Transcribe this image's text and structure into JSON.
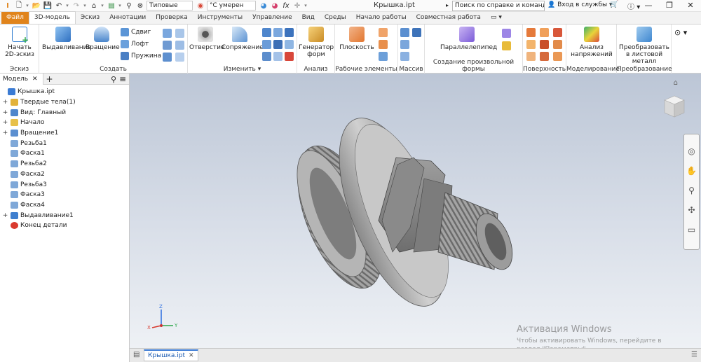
{
  "window": {
    "title": "Крышка.ipt",
    "search_placeholder": "Поиск по справке и командам...",
    "signin": "Вход в службы",
    "help": "?",
    "appearance_value": "Типовые",
    "material_value": "°С умерен",
    "minimize": "—",
    "maximize": "❐",
    "close": "✕"
  },
  "tabs": [
    {
      "label": "Файл"
    },
    {
      "label": "3D-модель"
    },
    {
      "label": "Эскиз"
    },
    {
      "label": "Аннотации"
    },
    {
      "label": "Проверка"
    },
    {
      "label": "Инструменты"
    },
    {
      "label": "Управление"
    },
    {
      "label": "Вид"
    },
    {
      "label": "Среды"
    },
    {
      "label": "Начало работы"
    },
    {
      "label": "Совместная работа"
    },
    {
      "label": "▭ ▾"
    }
  ],
  "ribbon": {
    "sketch": {
      "title": "Эскиз",
      "start_sketch": "Начать 2D-эскиз"
    },
    "create": {
      "title": "Создать",
      "extrude": "Выдавливание",
      "revolve": "Вращение",
      "sweep": "Сдвиг",
      "loft": "Лофт",
      "coil": "Пружина"
    },
    "modify": {
      "title": "Изменить ▾",
      "hole": "Отверстие",
      "fillet": "Сопряжение"
    },
    "analysis": {
      "title": "Анализ",
      "form_generator": "Генератор форм"
    },
    "work_features": {
      "title": "Рабочие элементы",
      "plane": "Плоскость"
    },
    "pattern": {
      "title": "Массив"
    },
    "freeform": {
      "title": "Создание произвольной формы",
      "box": "Параллелепипед"
    },
    "surface": {
      "title": "Поверхность"
    },
    "simulation": {
      "title": "Моделирование",
      "stress": "Анализ напряжений"
    },
    "convert": {
      "title": "Преобразование",
      "sheet_metal": "Преобразовать в листовой металл"
    }
  },
  "browser": {
    "tab_label": "Модель",
    "close": "✕",
    "add": "+",
    "items": [
      {
        "label": "Крышка.ipt",
        "expand": "",
        "indent": 0,
        "color": "#3b7bd3"
      },
      {
        "label": "Твердые тела(1)",
        "expand": "+",
        "indent": 1,
        "color": "#e2b23b"
      },
      {
        "label": "Вид: Главный",
        "expand": "+",
        "indent": 1,
        "color": "#4f86cc"
      },
      {
        "label": "Начало",
        "expand": "+",
        "indent": 1,
        "color": "#e7c04a"
      },
      {
        "label": "Вращение1",
        "expand": "+",
        "indent": 1,
        "color": "#5b8fd0"
      },
      {
        "label": "Резьба1",
        "expand": "",
        "indent": 1,
        "color": "#7fa8d8"
      },
      {
        "label": "Фаска1",
        "expand": "",
        "indent": 1,
        "color": "#7fa8d8"
      },
      {
        "label": "Резьба2",
        "expand": "",
        "indent": 1,
        "color": "#7fa8d8"
      },
      {
        "label": "Фаска2",
        "expand": "",
        "indent": 1,
        "color": "#7fa8d8"
      },
      {
        "label": "Резьба3",
        "expand": "",
        "indent": 1,
        "color": "#7fa8d8"
      },
      {
        "label": "Фаска3",
        "expand": "",
        "indent": 1,
        "color": "#7fa8d8"
      },
      {
        "label": "Фаска4",
        "expand": "",
        "indent": 1,
        "color": "#7fa8d8"
      },
      {
        "label": "Выдавливание1",
        "expand": "+",
        "indent": 1,
        "color": "#3f7fcf"
      },
      {
        "label": "Конец детали",
        "expand": "",
        "indent": 1,
        "color": "#d93a2e"
      }
    ]
  },
  "viewport": {
    "watermark_title": "Активация Windows",
    "watermark_sub": "Чтобы активировать Windows, перейдите в раздел \"Параметры\"."
  },
  "document_tab": {
    "label": "Крышка.ipt",
    "close": "✕"
  },
  "colors": {
    "file_tab": "#e0841c",
    "accent": "#3a7ad5",
    "part": "#9b9b9b"
  }
}
